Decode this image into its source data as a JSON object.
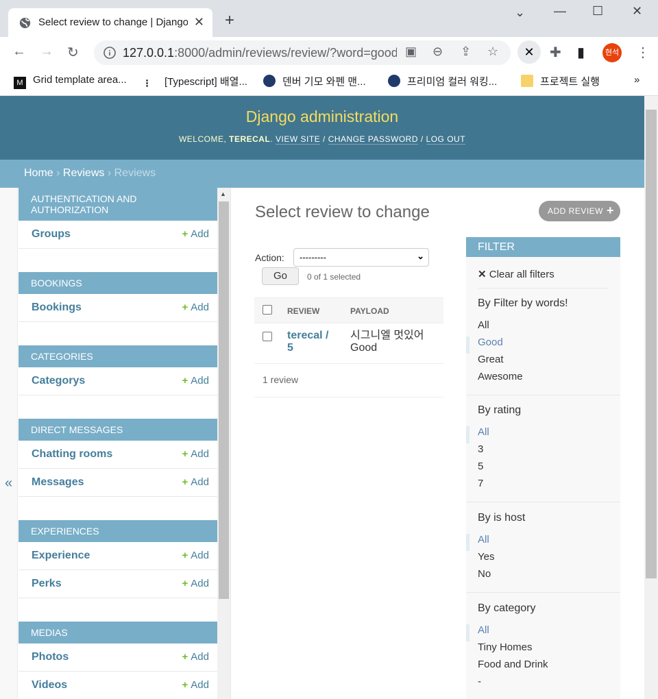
{
  "browser": {
    "tab_title": "Select review to change | Django",
    "url_host": "127.0.0.1",
    "url_rest": ":8000/admin/reviews/review/?word=good",
    "profile_label": "현석",
    "bookmarks": [
      "Grid template area...",
      "[Typescript] 배열...",
      "덴버 기모 와펜 맨...",
      "프리미엄 컬러 워킹...",
      "프로젝트 실행"
    ],
    "bookmarks_more": "»"
  },
  "header": {
    "branding": "Django administration",
    "welcome": "Welcome,",
    "username": "terecal",
    "view_site": "View site",
    "change_password": "Change password",
    "log_out": "Log out",
    "sep": "/"
  },
  "breadcrumbs": {
    "home": "Home",
    "app": "Reviews",
    "current": "Reviews",
    "sep": "›"
  },
  "sidebar": {
    "toggle": "«",
    "add_label": "Add",
    "modules": [
      {
        "caption": "Authentication and Authorization",
        "models": [
          "Groups"
        ]
      },
      {
        "caption": "Bookings",
        "models": [
          "Bookings"
        ]
      },
      {
        "caption": "Categories",
        "models": [
          "Categorys"
        ]
      },
      {
        "caption": "Direct Messages",
        "models": [
          "Chatting rooms",
          "Messages"
        ]
      },
      {
        "caption": "Experiences",
        "models": [
          "Experience",
          "Perks"
        ]
      },
      {
        "caption": "Medias",
        "models": [
          "Photos",
          "Videos"
        ]
      }
    ]
  },
  "content": {
    "title": "Select review to change",
    "add_button": "Add Review",
    "action_label": "Action:",
    "action_value": "---------",
    "go": "Go",
    "selected": "0 of 1 selected",
    "columns": [
      "Review",
      "Payload"
    ],
    "rows": [
      {
        "review": "terecal / 5",
        "payload": "시그니엘 멋있어 Good"
      }
    ],
    "count": "1 review"
  },
  "filter": {
    "title": "Filter",
    "clear": "Clear all filters",
    "groups": [
      {
        "title": "By Filter by words!",
        "options": [
          "All",
          "Good",
          "Great",
          "Awesome"
        ],
        "selected": 1
      },
      {
        "title": "By rating",
        "options": [
          "All",
          "3",
          "5",
          "7"
        ],
        "selected": 0
      },
      {
        "title": "By is host",
        "options": [
          "All",
          "Yes",
          "No"
        ],
        "selected": 0
      },
      {
        "title": "By category",
        "options": [
          "All",
          "Tiny Homes",
          "Food and Drink",
          "-"
        ],
        "selected": 0
      }
    ]
  },
  "colors": {
    "header": "#417690",
    "module": "#79aec8",
    "link": "#447e9b",
    "brand": "#f5dd5d",
    "add": "#70bf2b"
  }
}
